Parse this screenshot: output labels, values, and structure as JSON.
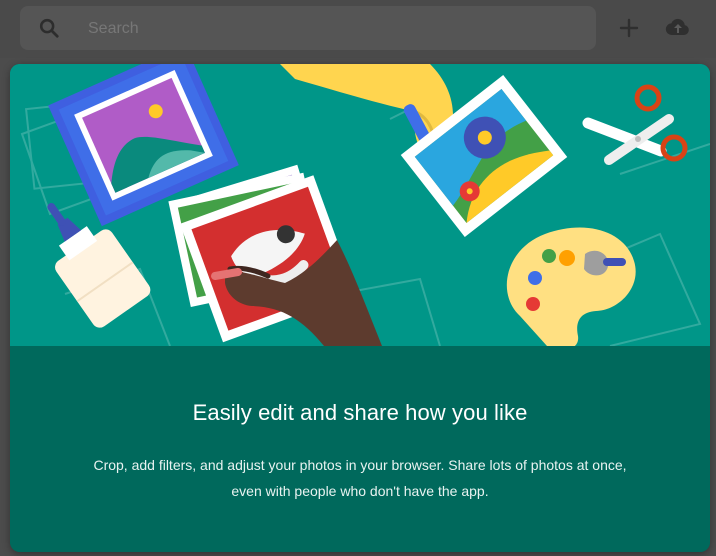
{
  "search": {
    "placeholder": "Search"
  },
  "toolbar": {
    "add_icon": "plus-icon",
    "upload_icon": "cloud-upload-icon"
  },
  "dialog": {
    "title": "Easily edit and share how you like",
    "description": "Crop, add filters, and adjust your photos in your browser. Share lots of photos at once, even with people who don't have the app."
  },
  "colors": {
    "topbar": "#4a4a4a",
    "hero": "#009688",
    "content": "#00695c",
    "accent_blue": "#3f6ee8",
    "accent_red": "#e53935",
    "accent_yellow": "#ffd54f"
  }
}
